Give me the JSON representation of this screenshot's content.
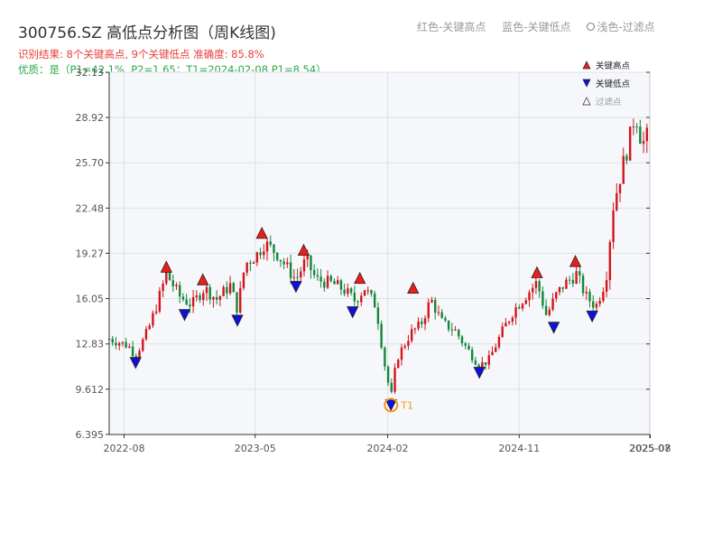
{
  "title": "300756.SZ 高低点分析图（周K线图)",
  "subtitle_result": "识别结果: 8个关键高点, 9个关键低点  准确度: 85.8%",
  "subtitle_quality": "优质：是（P1=42.1%, P2=1.65；T1=2024-02-08 P1=8.54）",
  "legend_top": {
    "red": "红色-关键高点",
    "blue": "蓝色-关键低点",
    "light": "浅色-过滤点"
  },
  "colors": {
    "up": "#d4141b",
    "down": "#16863a",
    "high_marker": "#ee1c1c",
    "low_marker": "#1010d8",
    "t1": "#f39a1c"
  },
  "chart_data": {
    "type": "candlestick",
    "x_range": [
      "2022-07-01",
      "2025-07-31"
    ],
    "y_range": [
      6.395,
      32.13
    ],
    "y_ticks": [
      "6.395",
      "9.612",
      "12.83",
      "16.05",
      "19.27",
      "22.48",
      "25.70",
      "28.92",
      "32.13"
    ],
    "x_ticks": [
      {
        "date": "2022-08-01",
        "label": "2022-08"
      },
      {
        "date": "2023-05-01",
        "label": "2023-05"
      },
      {
        "date": "2024-02-01",
        "label": "2024-02"
      },
      {
        "date": "2024-11-01",
        "label": "2024-11"
      },
      {
        "date": "2025-07-31",
        "label": "2025-07"
      },
      {
        "date": "2025-08-01",
        "label": "2025-08"
      }
    ],
    "legend": [
      {
        "name": "关键高点",
        "marker": "up-triangle"
      },
      {
        "name": "关键低点",
        "marker": "down-triangle"
      },
      {
        "name": "过滤点",
        "marker": "up-triangle-light"
      }
    ],
    "price_path": [
      [
        "2022-07-01",
        13.2
      ],
      [
        "2022-08-10",
        12.7
      ],
      [
        "2022-08-25",
        12.0
      ],
      [
        "2022-09-20",
        13.8
      ],
      [
        "2022-10-10",
        15.8
      ],
      [
        "2022-10-28",
        17.8
      ],
      [
        "2022-11-25",
        16.2
      ],
      [
        "2022-12-20",
        15.6
      ],
      [
        "2023-01-15",
        16.8
      ],
      [
        "2023-02-10",
        16.0
      ],
      [
        "2023-03-10",
        17.0
      ],
      [
        "2023-03-25",
        15.3
      ],
      [
        "2023-04-10",
        18.5
      ],
      [
        "2023-05-05",
        19.2
      ],
      [
        "2023-05-20",
        20.0
      ],
      [
        "2023-06-15",
        19.3
      ],
      [
        "2023-07-05",
        18.3
      ],
      [
        "2023-07-25",
        17.4
      ],
      [
        "2023-08-15",
        18.8
      ],
      [
        "2023-09-05",
        17.4
      ],
      [
        "2023-10-10",
        17.1
      ],
      [
        "2023-11-01",
        16.7
      ],
      [
        "2023-11-25",
        15.9
      ],
      [
        "2023-12-15",
        16.8
      ],
      [
        "2024-01-08",
        15.5
      ],
      [
        "2024-01-25",
        11.5
      ],
      [
        "2024-02-08",
        9.0
      ],
      [
        "2024-02-20",
        11.8
      ],
      [
        "2024-03-20",
        13.6
      ],
      [
        "2024-04-10",
        14.2
      ],
      [
        "2024-05-01",
        16.0
      ],
      [
        "2024-05-25",
        14.3
      ],
      [
        "2024-06-20",
        13.8
      ],
      [
        "2024-07-15",
        12.5
      ],
      [
        "2024-08-10",
        11.3
      ],
      [
        "2024-08-30",
        11.7
      ],
      [
        "2024-09-25",
        13.6
      ],
      [
        "2024-10-20",
        15.2
      ],
      [
        "2024-11-20",
        16.5
      ],
      [
        "2024-12-08",
        17.2
      ],
      [
        "2024-12-28",
        14.8
      ],
      [
        "2025-01-15",
        16.2
      ],
      [
        "2025-02-01",
        17.0
      ],
      [
        "2025-02-28",
        17.8
      ],
      [
        "2025-03-20",
        16.2
      ],
      [
        "2025-04-10",
        15.5
      ],
      [
        "2025-05-01",
        17.5
      ],
      [
        "2025-05-15",
        22.5
      ],
      [
        "2025-06-01",
        25.0
      ],
      [
        "2025-06-20",
        27.5
      ],
      [
        "2025-07-01",
        29.4
      ],
      [
        "2025-07-15",
        27.0
      ],
      [
        "2025-07-31",
        27.8
      ]
    ],
    "key_highs": [
      {
        "date": "2022-10-28",
        "price": 17.8
      },
      {
        "date": "2023-01-12",
        "price": 16.9
      },
      {
        "date": "2023-05-15",
        "price": 20.2
      },
      {
        "date": "2023-08-10",
        "price": 19.0
      },
      {
        "date": "2023-12-05",
        "price": 17.0
      },
      {
        "date": "2024-03-25",
        "price": 16.3
      },
      {
        "date": "2024-12-08",
        "price": 17.4
      },
      {
        "date": "2025-02-26",
        "price": 18.2
      }
    ],
    "key_lows": [
      {
        "date": "2022-08-25",
        "price": 12.0
      },
      {
        "date": "2022-12-05",
        "price": 15.4
      },
      {
        "date": "2023-03-25",
        "price": 15.0
      },
      {
        "date": "2023-07-25",
        "price": 17.4
      },
      {
        "date": "2023-11-20",
        "price": 15.6
      },
      {
        "date": "2024-02-08",
        "price": 9.0
      },
      {
        "date": "2024-08-10",
        "price": 11.3
      },
      {
        "date": "2025-01-12",
        "price": 14.5
      },
      {
        "date": "2025-04-02",
        "price": 15.3
      }
    ],
    "annotation": {
      "label": "T1",
      "date": "2024-02-08",
      "price": 9.0
    }
  }
}
